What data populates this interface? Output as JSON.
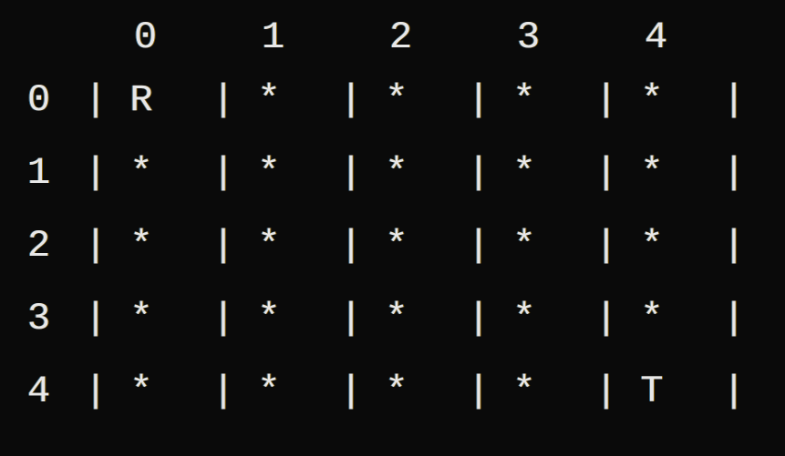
{
  "grid": {
    "colHeaders": [
      "0",
      "1",
      "2",
      "3",
      "4"
    ],
    "rowLabels": [
      "0",
      "1",
      "2",
      "3",
      "4"
    ],
    "pipe": "|",
    "cells": [
      [
        "R",
        "*",
        "*",
        "*",
        "*"
      ],
      [
        "*",
        "*",
        "*",
        "*",
        "*"
      ],
      [
        "*",
        "*",
        "*",
        "*",
        "*"
      ],
      [
        "*",
        "*",
        "*",
        "*",
        "*"
      ],
      [
        "*",
        "*",
        "*",
        "*",
        "T"
      ]
    ]
  }
}
